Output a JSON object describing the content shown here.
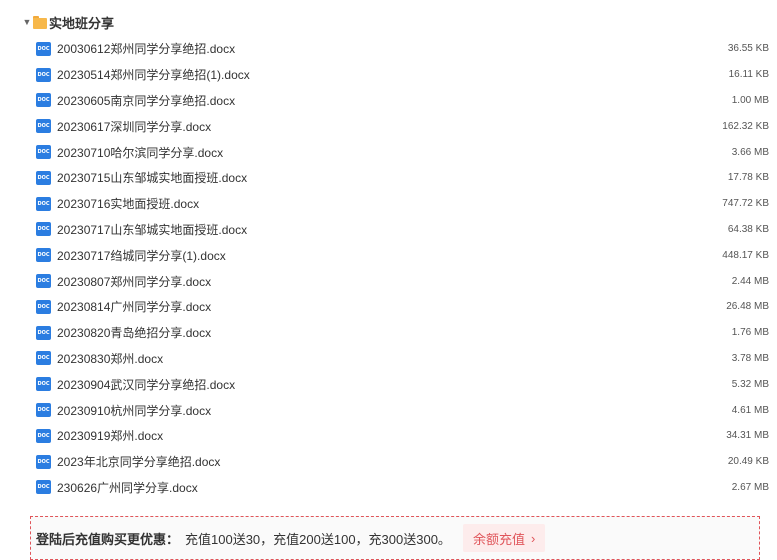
{
  "folder": {
    "title": "实地班分享",
    "caret_icon": "triangle-down-icon",
    "folder_icon": "folder-icon",
    "color": "#f7b84b"
  },
  "file_icon": {
    "label": "DOC",
    "name": "doc-file-icon",
    "color": "#2b7de1"
  },
  "files": [
    {
      "name": "20030612郑州同学分享绝招.docx",
      "size": "36.55 KB"
    },
    {
      "name": "20230514郑州同学分享绝招(1).docx",
      "size": "16.11 KB"
    },
    {
      "name": "20230605南京同学分享绝招.docx",
      "size": "1.00 MB"
    },
    {
      "name": "20230617深圳同学分享.docx",
      "size": "162.32 KB"
    },
    {
      "name": "20230710哈尔滨同学分享.docx",
      "size": "3.66 MB"
    },
    {
      "name": "20230715山东邹城实地面授班.docx",
      "size": "17.78 KB"
    },
    {
      "name": "20230716实地面授班.docx",
      "size": "747.72 KB"
    },
    {
      "name": "20230717山东邹城实地面授班.docx",
      "size": "64.38 KB"
    },
    {
      "name": "20230717绉城同学分享(1).docx",
      "size": "448.17 KB"
    },
    {
      "name": "20230807郑州同学分享.docx",
      "size": "2.44 MB"
    },
    {
      "name": "20230814广州同学分享.docx",
      "size": "26.48 MB"
    },
    {
      "name": "20230820青岛绝招分享.docx",
      "size": "1.76 MB"
    },
    {
      "name": "20230830郑州.docx",
      "size": "3.78 MB"
    },
    {
      "name": "20230904武汉同学分享绝招.docx",
      "size": "5.32 MB"
    },
    {
      "name": "20230910杭州同学分享.docx",
      "size": "4.61 MB"
    },
    {
      "name": "20230919郑州.docx",
      "size": "34.31 MB"
    },
    {
      "name": "2023年北京同学分享绝招.docx",
      "size": "20.49 KB"
    },
    {
      "name": "230626广州同学分享.docx",
      "size": "2.67 MB"
    }
  ],
  "promo": {
    "label": "登陆后充值购买更优惠：",
    "text": "充值100送30，充值200送100，充300送300。",
    "button_label": "余额充值",
    "button_icon": "chevron-right-icon",
    "accent_color": "#e0555a"
  }
}
